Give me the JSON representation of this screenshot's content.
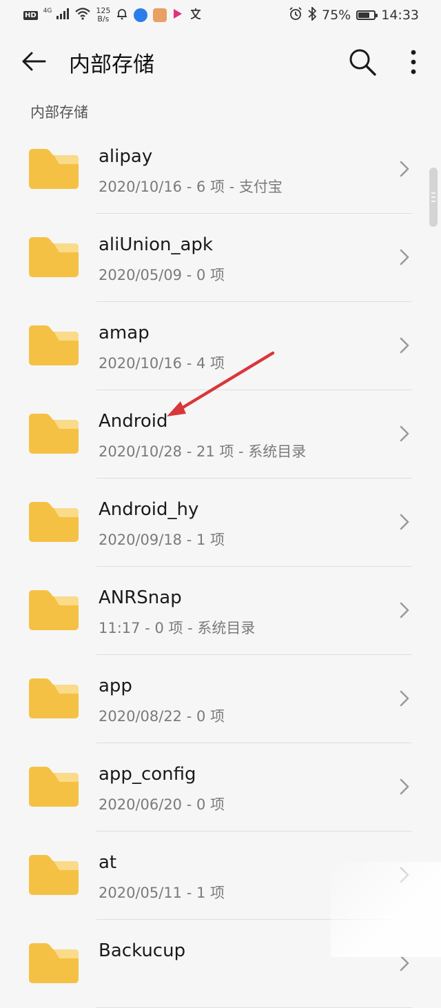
{
  "status_bar": {
    "hd_label": "HD",
    "net_label": "4G",
    "speed_value": "125",
    "speed_unit": "B/s",
    "battery_percent": "75%",
    "battery_level": 0.75,
    "time": "14:33",
    "icons": [
      "signal-icon",
      "wifi-icon",
      "notification-bell-icon",
      "browser-app-icon",
      "game-app-icon",
      "video-app-icon",
      "translate-app-icon",
      "alarm-icon",
      "bluetooth-icon",
      "battery-icon"
    ]
  },
  "header": {
    "title": "内部存储",
    "icons": [
      "back-arrow-icon",
      "search-icon",
      "more-vertical-icon"
    ]
  },
  "breadcrumb": "内部存储",
  "colors": {
    "folder_main": "#f5c144",
    "folder_tab": "#fadb8a",
    "annotation_arrow": "#d9373a",
    "background": "#f6f6f6"
  },
  "files": [
    {
      "name": "alipay",
      "meta": "2020/10/16 - 6 项 - 支付宝"
    },
    {
      "name": "aliUnion_apk",
      "meta": "2020/05/09 - 0 项"
    },
    {
      "name": "amap",
      "meta": "2020/10/16 - 4 项"
    },
    {
      "name": "Android",
      "meta": "2020/10/28 - 21 项 - 系统目录"
    },
    {
      "name": "Android_hy",
      "meta": "2020/09/18 - 1 项"
    },
    {
      "name": "ANRSnap",
      "meta": "11:17 - 0 项 - 系统目录"
    },
    {
      "name": "app",
      "meta": "2020/08/22 - 0 项"
    },
    {
      "name": "app_config",
      "meta": "2020/06/20 - 0 项"
    },
    {
      "name": "at",
      "meta": "2020/05/11 - 1 项"
    },
    {
      "name": "Backucup",
      "meta": ""
    }
  ]
}
